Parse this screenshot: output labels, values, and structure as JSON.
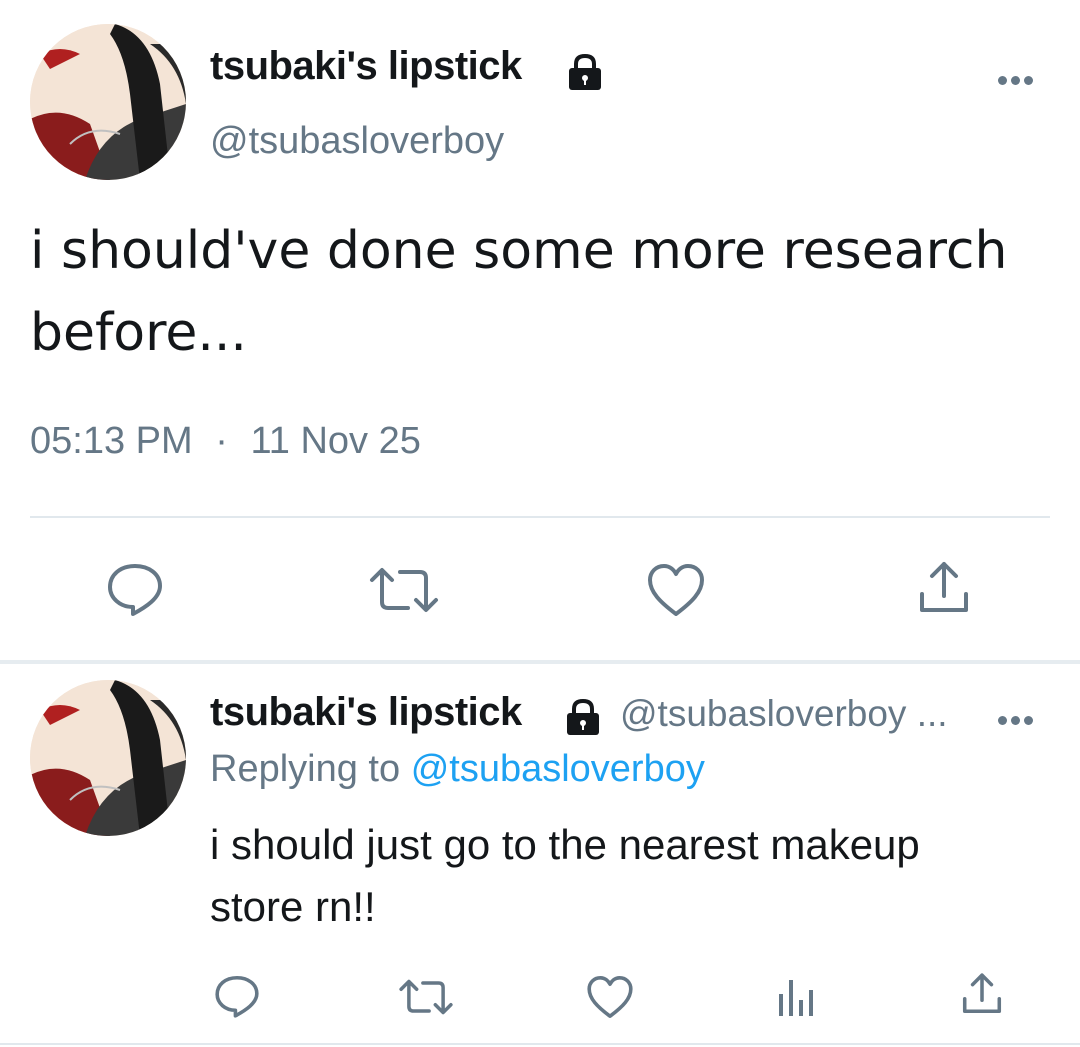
{
  "tweet": {
    "display_name": "tsubaki's lipstick",
    "handle": "@tsubasloverboy",
    "text": "i should've done some more research before...",
    "time": "05:13 PM",
    "date_separator": "·",
    "date": "11 Nov 25"
  },
  "reply": {
    "display_name": "tsubaki's lipstick",
    "handle": "@tsubasloverboy ...",
    "replying_prefix": "Replying to",
    "replying_handle": "@tsubasloverboy",
    "text": "i should just go to the nearest makeup store rn!!"
  },
  "icons": {
    "lock": "lock-icon",
    "more": "more-icon",
    "reply": "reply-icon",
    "retweet": "retweet-icon",
    "like": "like-icon",
    "share": "share-icon",
    "analytics": "analytics-icon"
  },
  "colors": {
    "text": "#14171a",
    "secondary": "#657786",
    "link": "#1da1f2",
    "divider": "#e1e8ed"
  }
}
